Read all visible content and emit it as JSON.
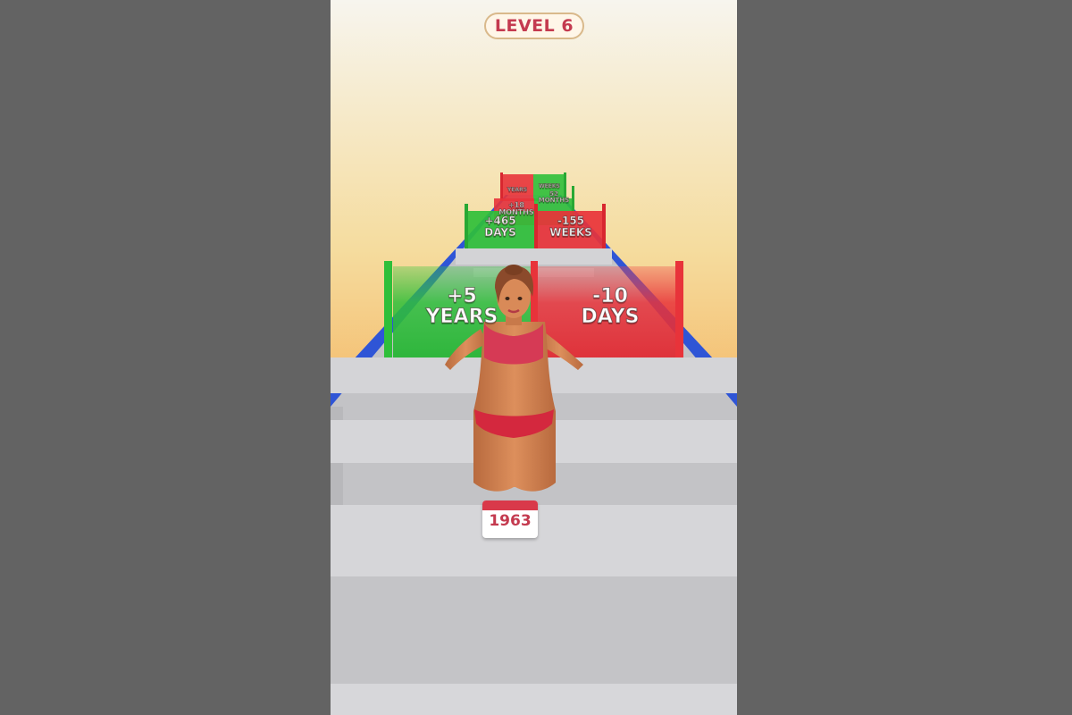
{
  "hud": {
    "level_label": "LEVEL 6"
  },
  "gates": {
    "near_left": {
      "value": "+5",
      "unit": "YEARS",
      "color": "#2fbf3a"
    },
    "near_right": {
      "value": "-10",
      "unit": "DAYS",
      "color": "#e8333a"
    },
    "mid_left": {
      "value": "+465",
      "unit": "DAYS",
      "color": "#2fbf3a"
    },
    "mid_right": {
      "value": "-155",
      "unit": "WEEKS",
      "color": "#e8333a"
    },
    "far_left": {
      "value": "+18",
      "unit": "MONTHS",
      "color": "#e8333a"
    },
    "far_right": {
      "value": "52",
      "unit": "MONTHS",
      "color": "#2fbf3a"
    },
    "farthest_left": {
      "value": "",
      "unit": "YEARS",
      "color": "#e8333a"
    },
    "farthest_right": {
      "value": "",
      "unit": "WEEKS",
      "color": "#2fbf3a"
    }
  },
  "player": {
    "year_badge": "1963",
    "icon": "calendar-icon"
  },
  "colors": {
    "track": "#c9c9cc",
    "rail": "#2f55d6",
    "sky_top": "#f6f3ea",
    "sky_bottom": "#f39a3a",
    "positive_gate": "#2fbf3a",
    "negative_gate": "#e8333a"
  }
}
